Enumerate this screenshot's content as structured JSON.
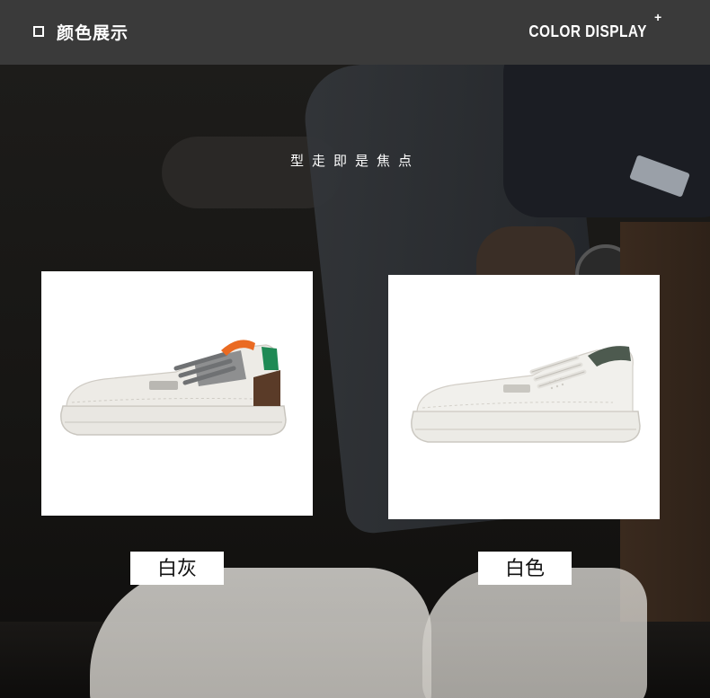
{
  "header": {
    "title_cn": "颜色展示",
    "title_en": "COLOR DISPLAY",
    "plus_symbol": "+"
  },
  "tagline": "型走即是焦点",
  "products": [
    {
      "label": "白灰",
      "accent_colors": [
        "#e8e6e1",
        "#8e8f90",
        "#ea6a22",
        "#1f8a55",
        "#5a3b28"
      ]
    },
    {
      "label": "白色",
      "accent_colors": [
        "#ecebe6",
        "#4d5a4f"
      ]
    }
  ],
  "icons": {
    "header_marker": "square-outline-icon"
  }
}
